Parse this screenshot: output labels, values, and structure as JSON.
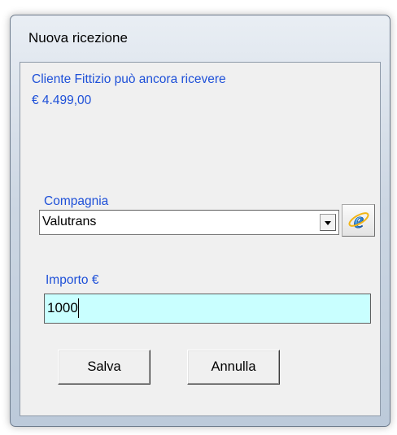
{
  "window": {
    "title": "Nuova ricezione"
  },
  "info": {
    "line1": "Cliente Fittizio può ancora ricevere",
    "line2": "€ 4.499,00"
  },
  "company": {
    "label": "Compagnia",
    "selected": "Valutrans",
    "dropdown_icon": "chevron-down-icon",
    "action_icon": "internet-explorer-icon"
  },
  "amount": {
    "label": "Importo €",
    "value": "1000"
  },
  "buttons": {
    "save": "Salva",
    "cancel": "Annulla"
  },
  "colors": {
    "label_blue": "#1e50d8",
    "amount_field_bg": "#c9ffff"
  }
}
